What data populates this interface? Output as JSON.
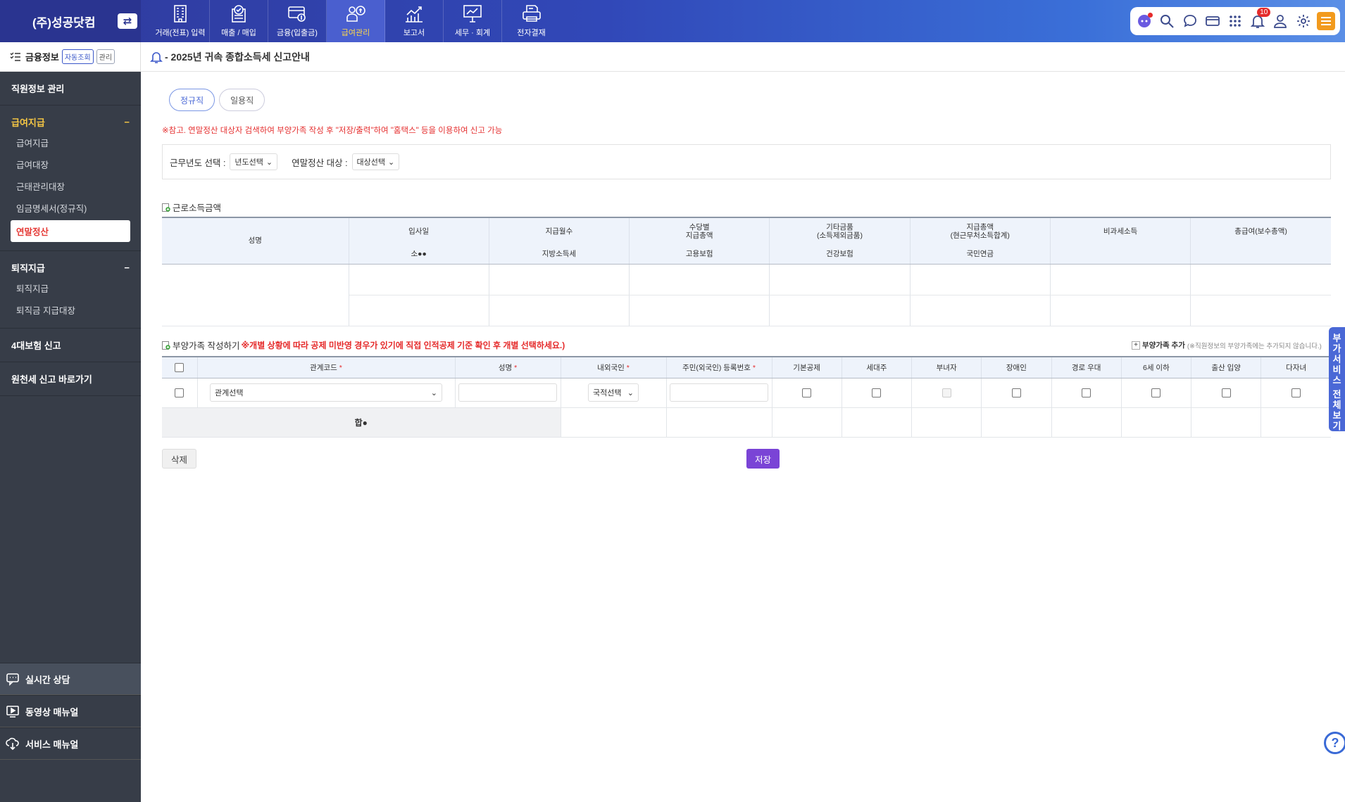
{
  "brand": {
    "name": "(주)성공닷컴",
    "switch_icon": "⇄"
  },
  "topnav": [
    {
      "label": "거래(전표) 입력",
      "icon": "building-icon"
    },
    {
      "label": "매출 / 매입",
      "icon": "document-check-icon"
    },
    {
      "label": "금융(입출금)",
      "icon": "card-coin-icon"
    },
    {
      "label": "급여관리",
      "icon": "person-money-icon",
      "active": true
    },
    {
      "label": "보고서",
      "icon": "chart-up-icon"
    },
    {
      "label": "세무 · 회계",
      "icon": "presentation-chart-icon"
    },
    {
      "label": "전자결재",
      "icon": "printer-document-icon"
    }
  ],
  "tools": {
    "notification_count": "10"
  },
  "sidebar": {
    "head": {
      "title": "금융정보",
      "chip_auto": "자동조회",
      "chip_manage": "관리"
    },
    "sections": [
      {
        "title": "직원정보 관리"
      },
      {
        "title": "급여지급",
        "toggle": "−",
        "items": [
          "급여지급",
          "급여대장",
          "근태관리대장",
          "임금명세서(정규직)",
          "연말정산"
        ]
      },
      {
        "title": "퇴직지급",
        "toggle": "−",
        "items": [
          "퇴직지급",
          "퇴직금 지급대장"
        ]
      },
      {
        "title": "4대보험 신고"
      },
      {
        "title": "원천세 신고 바로가기"
      }
    ],
    "bottom": [
      "실시간 상담",
      "동영상 매뉴얼",
      "서비스 매뉴얼"
    ]
  },
  "page": {
    "title": "- 2025년 귀속 종합소득세 신고안내",
    "tabs": [
      "정규직",
      "일용직"
    ],
    "notice": "※참고. 연말정산 대상자 검색하여 부양가족 작성 후 \"저장/출력\"하여 \"홈택스\" 등을 이용하여 신고 가능",
    "filter": {
      "year_label": "근무년도 선택 :",
      "year_value": "년도선택",
      "target_label": "연말정산 대상 :",
      "target_value": "대상선택"
    }
  },
  "income_table": {
    "title": "근로소득금액",
    "name_header": "성명",
    "headers_top": [
      "입사일",
      "지급월수",
      "수당별\n지급총액",
      "기타금품\n(소득제외금품)",
      "지급총액\n(현근무처소득합계)",
      "비과세소득",
      "총급여(보수총액)"
    ],
    "headers_bottom": [
      "소●●",
      "지방소득세",
      "고용보험",
      "건강보험",
      "국민연금",
      "",
      ""
    ]
  },
  "dependents": {
    "title": "부양가족 작성하기",
    "warning": "※개별 상황에 따라 공제 미반영 경우가 있기에 직접 인적공제 기준 확인 후 개별 선택하세요.)",
    "add_label": "부양가족 추가",
    "add_note": "(※직원정보의 부양가족에는 추가되지 않습니다.)",
    "headers": [
      "관계코드",
      "성명",
      "내외국인",
      "주민(외국인) 등록번호",
      "기본공제",
      "세대주",
      "부녀자",
      "장애인",
      "경로 우대",
      "6세 이하",
      "출산 입양",
      "다자녀"
    ],
    "required_mark": "*",
    "relation_value": "관계선택",
    "nationality_value": "국적선택",
    "sum_label": "합●"
  },
  "buttons": {
    "delete": "삭제",
    "save": "저장"
  },
  "side_tab": [
    "부",
    "가",
    "서",
    "비",
    "스",
    "",
    "전",
    "체",
    "보",
    "기"
  ],
  "help": "?"
}
